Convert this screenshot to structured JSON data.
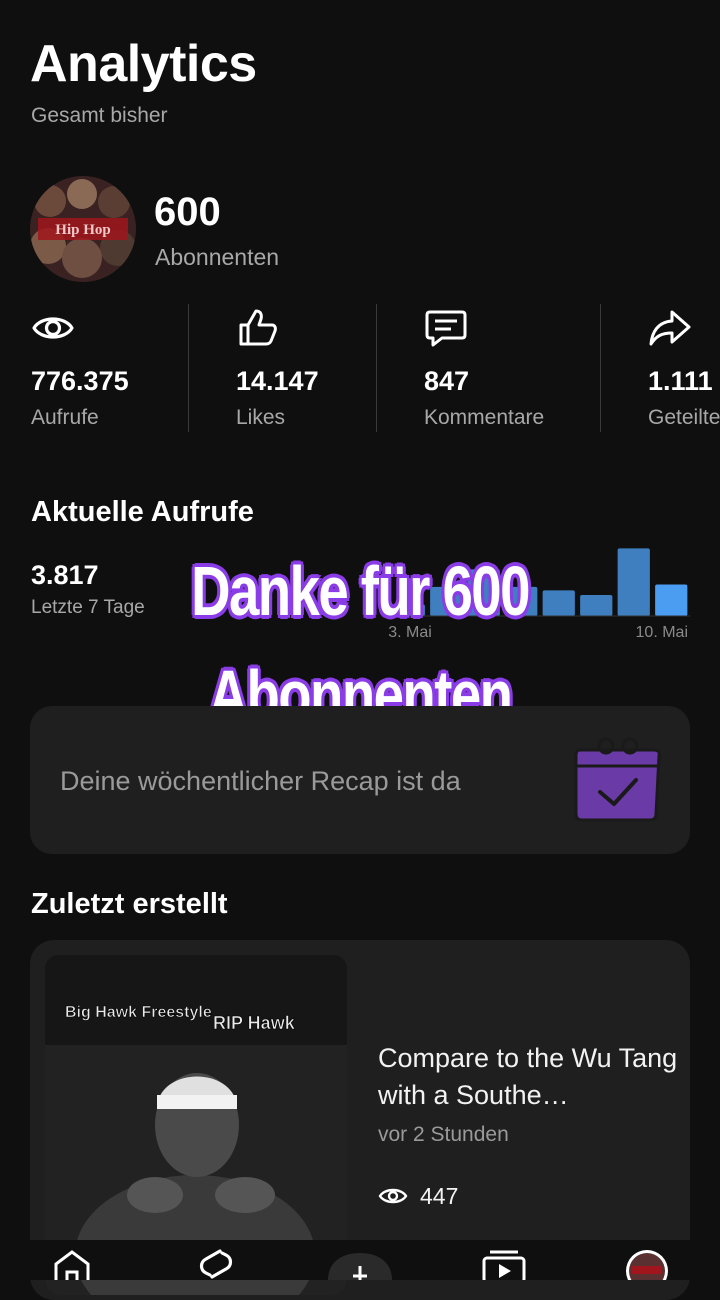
{
  "header": {
    "title": "Analytics",
    "subtitle": "Gesamt bisher"
  },
  "channel": {
    "subscribers": "600",
    "subscribers_label": "Abonnenten"
  },
  "stats": [
    {
      "icon": "eye-icon",
      "value": "776.375",
      "label": "Aufrufe"
    },
    {
      "icon": "thumbs-up-icon",
      "value": "14.147",
      "label": "Likes"
    },
    {
      "icon": "comment-icon",
      "value": "847",
      "label": "Kommentare"
    },
    {
      "icon": "share-icon",
      "value": "1.111",
      "label": "Geteilte"
    }
  ],
  "recent_views": {
    "title": "Aktuelle Aufrufe",
    "value": "3.817",
    "period": "Letzte 7 Tage"
  },
  "chart_data": {
    "type": "bar",
    "categories": [
      "",
      "",
      "",
      "",
      "",
      "",
      "",
      ""
    ],
    "series": [
      {
        "values": [
          10,
          25,
          40,
          25,
          22,
          18,
          58,
          27
        ]
      }
    ],
    "tick_labels": [
      "3. Mai",
      "10. Mai"
    ],
    "highlight_color": "#4a9df0",
    "bar_color": "#3f7fc0",
    "ylim": [
      0,
      60
    ],
    "grid": false
  },
  "overlay": {
    "line1": "Danke für 600",
    "line2": "Abonnenten"
  },
  "recap": {
    "text": "Deine wöchentlicher Recap ist da",
    "icon": "calendar-check-icon"
  },
  "recent_created": {
    "title": "Zuletzt erstellt",
    "video": {
      "thumb_caption_1": "Big Hawk Freestyle",
      "thumb_caption_2": "RIP Hawk",
      "title": "Compare to the Wu Tang with a Southe…",
      "time": "vor 2 Stunden",
      "views": "447"
    }
  },
  "bottom_nav": {
    "items": [
      "home-icon",
      "shorts-icon",
      "create-icon",
      "subscriptions-icon",
      "profile-avatar"
    ]
  },
  "colors": {
    "background": "#0f0f0f",
    "card": "#1f1f1f",
    "muted_text": "#a8a8a8",
    "overlay_outline": "#8a3ce6"
  }
}
